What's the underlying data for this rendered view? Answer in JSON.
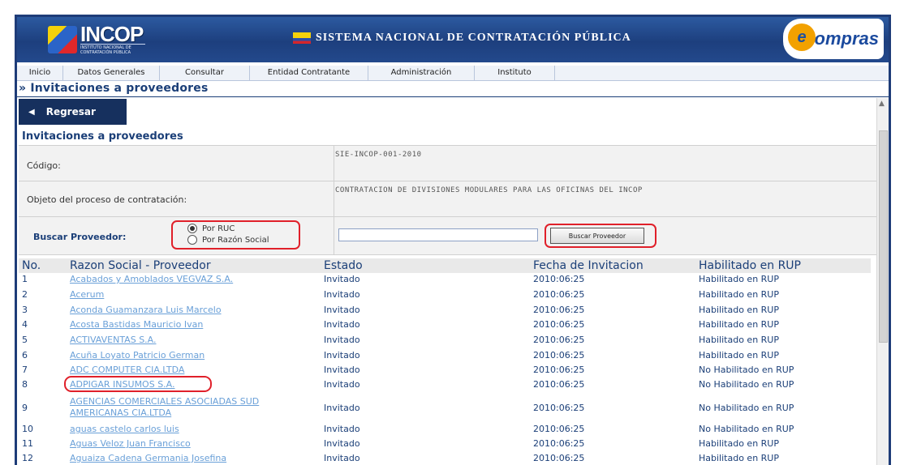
{
  "header": {
    "logo_incop": "INCOP",
    "logo_incop_sub": "INSTITUTO NACIONAL DE CONTRATACIÓN PÚBLICA",
    "system_title": "SISTEMA NACIONAL DE CONTRATACIÓN PÚBLICA",
    "logo_compras": "Compras",
    "logo_compras_mark": "e"
  },
  "nav": {
    "items": [
      {
        "label": "Inicio"
      },
      {
        "label": "Datos Generales"
      },
      {
        "label": "Consultar"
      },
      {
        "label": "Entidad Contratante"
      },
      {
        "label": "Administración"
      },
      {
        "label": "Instituto"
      }
    ]
  },
  "breadcrumb": "» Invitaciones a proveedores",
  "back_button": "Regresar",
  "section_title": "Invitaciones a proveedores",
  "form": {
    "codigo_label": "Código:",
    "codigo_value": "SIE-INCOP-001-2010",
    "objeto_label": "Objeto del proceso de contratación:",
    "objeto_value": "CONTRATACION DE DIVISIONES MODULARES PARA LAS OFICINAS DEL INCOP",
    "buscar_label": "Buscar Proveedor:",
    "radio_ruc": "Por RUC",
    "radio_razon": "Por Razón Social",
    "search_value": "",
    "search_button": "Buscar Proveedor"
  },
  "table": {
    "headers": [
      "No.",
      "Razon Social - Proveedor",
      "Estado",
      "Fecha de Invitacion",
      "Habilitado en RUP"
    ],
    "rows": [
      {
        "no": "1",
        "name": "Acabados y Amoblados VEGVAZ S.A.",
        "name2": "",
        "estado": "Invitado",
        "fecha": "2010:06:25",
        "rup": "Habilitado en RUP"
      },
      {
        "no": "2",
        "name": "Acerum",
        "name2": "",
        "estado": "Invitado",
        "fecha": "2010:06:25",
        "rup": "Habilitado en RUP"
      },
      {
        "no": "3",
        "name": "Aconda Guamanzara Luis Marcelo",
        "name2": "",
        "estado": "Invitado",
        "fecha": "2010:06:25",
        "rup": "Habilitado en RUP"
      },
      {
        "no": "4",
        "name": "Acosta Bastidas Mauricio Ivan",
        "name2": "",
        "estado": "Invitado",
        "fecha": "2010:06:25",
        "rup": "Habilitado en RUP"
      },
      {
        "no": "5",
        "name": "ACTIVAVENTAS S.A.",
        "name2": "",
        "estado": "Invitado",
        "fecha": "2010:06:25",
        "rup": "Habilitado en RUP"
      },
      {
        "no": "6",
        "name": "Acuña Loyato Patricio German",
        "name2": "",
        "estado": "Invitado",
        "fecha": "2010:06:25",
        "rup": "Habilitado en RUP"
      },
      {
        "no": "7",
        "name": "ADC COMPUTER CIA.LTDA",
        "name2": "",
        "estado": "Invitado",
        "fecha": "2010:06:25",
        "rup": "No Habilitado en RUP"
      },
      {
        "no": "8",
        "name": "ADPIGAR INSUMOS S.A.",
        "name2": "",
        "estado": "Invitado",
        "fecha": "2010:06:25",
        "rup": "No Habilitado en RUP"
      },
      {
        "no": "9",
        "name": "AGENCIAS COMERCIALES ASOCIADAS SUD",
        "name2": "AMERICANAS CIA.LTDA",
        "estado": "Invitado",
        "fecha": "2010:06:25",
        "rup": "No Habilitado en RUP"
      },
      {
        "no": "10",
        "name": "aguas castelo carlos luis",
        "name2": "",
        "estado": "Invitado",
        "fecha": "2010:06:25",
        "rup": "No Habilitado en RUP"
      },
      {
        "no": "11",
        "name": "Aguas Veloz Juan Francisco",
        "name2": "",
        "estado": "Invitado",
        "fecha": "2010:06:25",
        "rup": "Habilitado en RUP"
      },
      {
        "no": "12",
        "name": "Aguaiza Cadena Germania Josefina",
        "name2": "",
        "estado": "Invitado",
        "fecha": "2010:06:25",
        "rup": "Habilitado en RUP"
      }
    ]
  },
  "colors": {
    "header_blue": "#1d3f7e",
    "highlight_red": "#e0202a",
    "link_blue": "#6aa0d8"
  }
}
